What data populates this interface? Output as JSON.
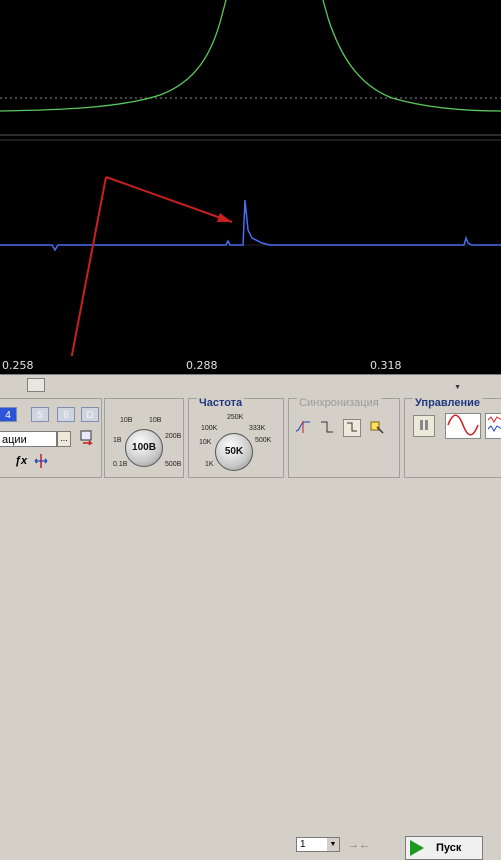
{
  "oscilloscope": {
    "x_ticks": [
      "0.258",
      "0.288",
      "0.318"
    ],
    "trace_colors": {
      "upper": "#5cc85c",
      "lower": "#4a6cf0",
      "grid": "#606060",
      "annotation_arrow": "#c82020"
    }
  },
  "channel_tabs": [
    {
      "label": "4",
      "active": true
    },
    {
      "label": "5",
      "active": false
    },
    {
      "label": "6",
      "active": false
    },
    {
      "label": "D",
      "active": false
    }
  ],
  "function_field": {
    "value": "ации",
    "more_label": "..."
  },
  "icons": {
    "fx": "fx-icon",
    "cursor": "cursor-icon",
    "stop": "pause-icon"
  },
  "amplitude": {
    "value": "100В",
    "ticks": [
      "10В",
      "1В",
      "200В",
      "0.1В",
      "500В"
    ]
  },
  "frequency": {
    "title": "Частота",
    "value": "50K",
    "ticks": [
      "250K",
      "100K",
      "333K",
      "10K",
      "500K",
      "1K"
    ]
  },
  "sync": {
    "title": "Синхронизация",
    "selected": "1"
  },
  "control": {
    "title": "Управление",
    "run_label": "Пуск"
  }
}
